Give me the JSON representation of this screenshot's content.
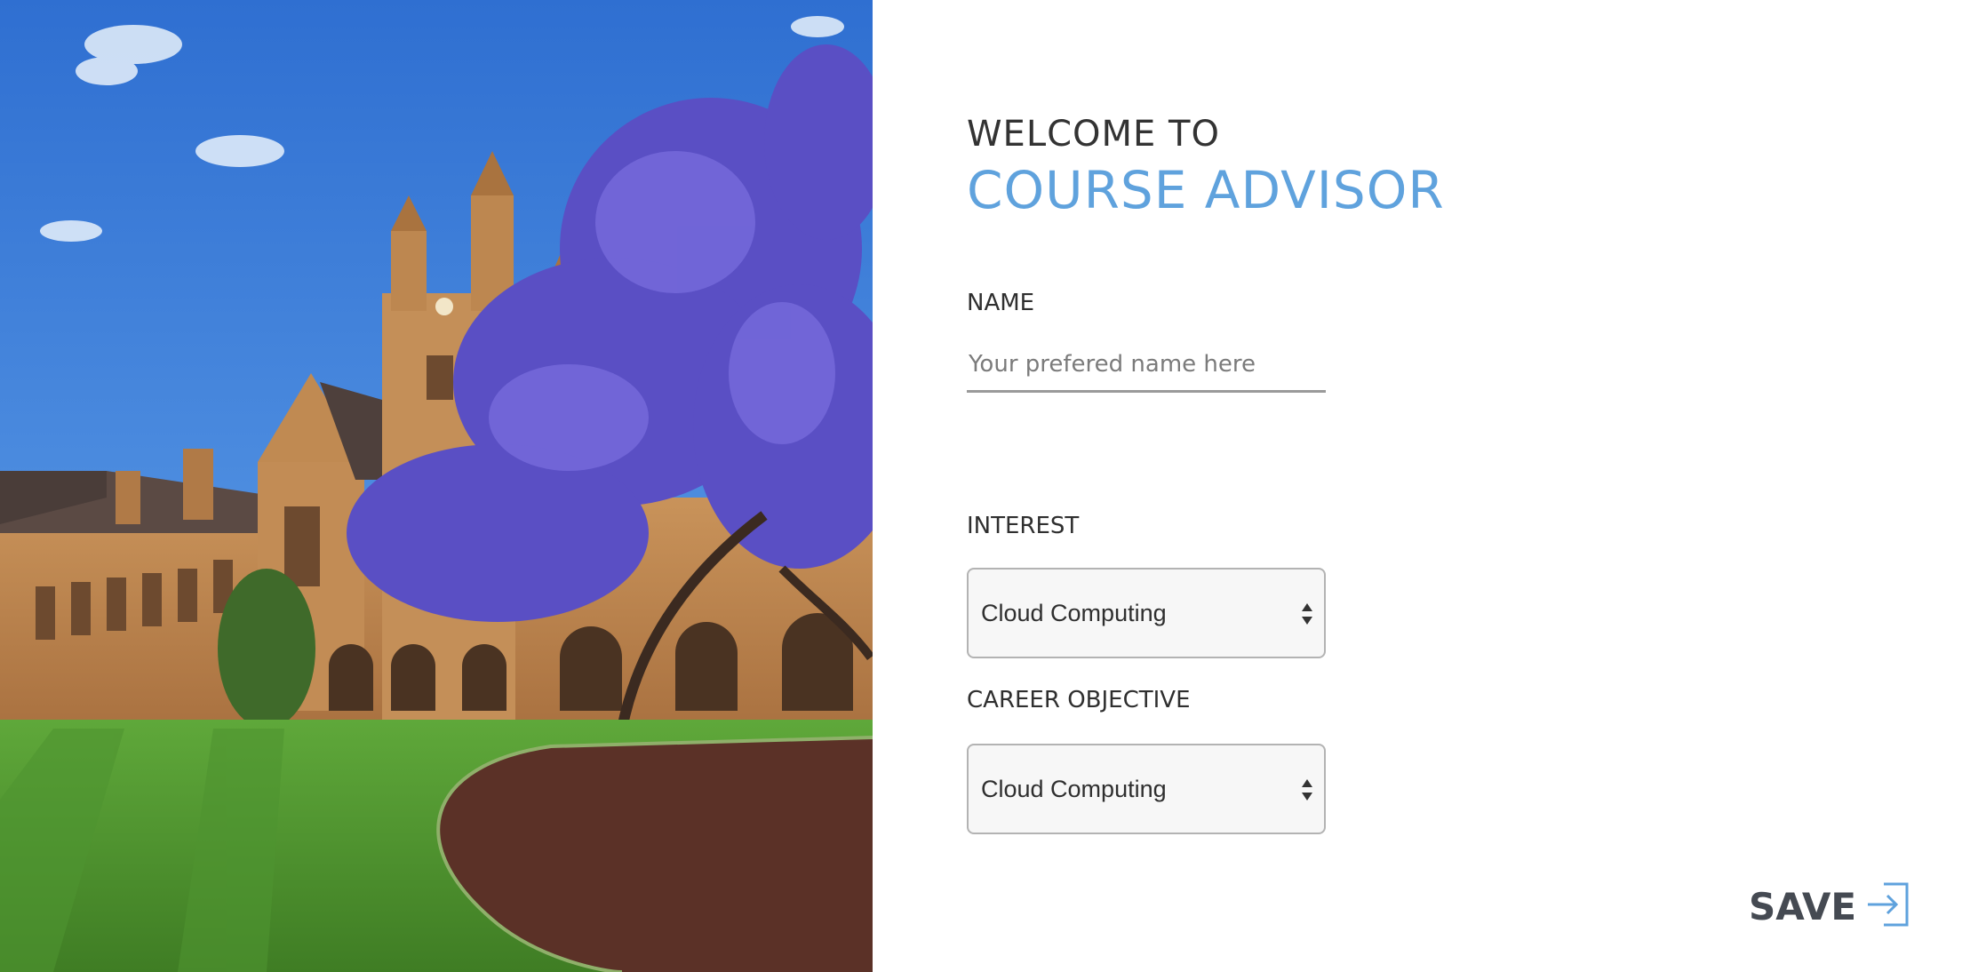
{
  "header": {
    "welcome": "WELCOME TO",
    "title": "COURSE ADVISOR"
  },
  "form": {
    "name_label": "NAME",
    "name_placeholder": "Your prefered name here",
    "interest_label": "INTEREST",
    "interest_value": "Cloud Computing",
    "career_label": "CAREER OBJECTIVE",
    "career_value": "Cloud Computing",
    "save_label": "SAVE"
  },
  "icons": {
    "select_arrows": "sort-arrows-icon",
    "save": "sign-in-arrow-icon"
  },
  "colors": {
    "accent": "#5fa2dd",
    "text": "#333333",
    "save_text": "#454a52"
  }
}
